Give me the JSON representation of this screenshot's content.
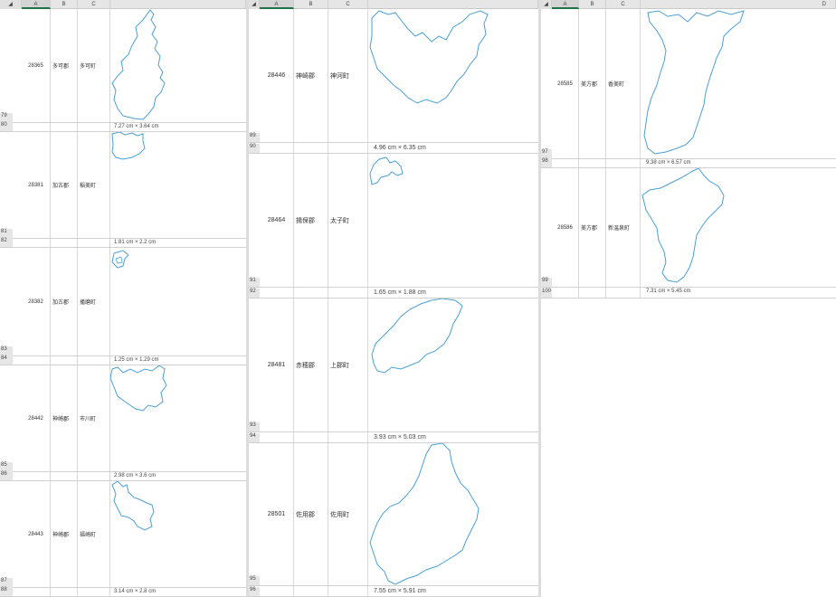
{
  "panes": [
    {
      "columns": [
        "A",
        "B",
        "C"
      ],
      "rows": [
        {
          "num": "79",
          "code": "28365",
          "district": "多可郡",
          "town": "多可町"
        },
        {
          "num": "80",
          "size": "7.27 cm × 3.64 cm"
        },
        {
          "num": "81",
          "code": "28381",
          "district": "加古郡",
          "town": "稲美町"
        },
        {
          "num": "82",
          "size": "1.81 cm × 2.2 cm"
        },
        {
          "num": "83",
          "code": "28382",
          "district": "加古郡",
          "town": "播磨町"
        },
        {
          "num": "84",
          "size": "1.25 cm × 1.29 cm"
        },
        {
          "num": "85",
          "code": "28442",
          "district": "神崎郡",
          "town": "市川町"
        },
        {
          "num": "86",
          "size": "2.98 cm × 3.6 cm"
        },
        {
          "num": "87",
          "code": "28443",
          "district": "神崎郡",
          "town": "福崎町"
        },
        {
          "num": "88",
          "size": "3.14 cm × 2.8 cm"
        }
      ]
    },
    {
      "columns": [
        "A",
        "B",
        "C"
      ],
      "rows": [
        {
          "num": "89",
          "code": "28446",
          "district": "神崎郡",
          "town": "神河町"
        },
        {
          "num": "90",
          "size": "4.96 cm × 6.35 cm"
        },
        {
          "num": "91",
          "code": "28464",
          "district": "揖保郡",
          "town": "太子町"
        },
        {
          "num": "92",
          "size": "1.65 cm × 1.88 cm"
        },
        {
          "num": "93",
          "code": "28481",
          "district": "赤穂郡",
          "town": "上郡町"
        },
        {
          "num": "94",
          "size": "3.93 cm × 5.03 cm"
        },
        {
          "num": "95",
          "code": "28501",
          "district": "佐用郡",
          "town": "佐用町"
        },
        {
          "num": "96",
          "size": "7.55 cm × 5.91 cm"
        }
      ]
    },
    {
      "columns": [
        "A",
        "B",
        "C",
        "D"
      ],
      "rows": [
        {
          "num": "97",
          "code": "28585",
          "district": "美方郡",
          "town": "香美町"
        },
        {
          "num": "98",
          "size": "9.38 cm × 6.57 cm"
        },
        {
          "num": "99",
          "code": "28586",
          "district": "美方郡",
          "town": "新温泉町"
        },
        {
          "num": "100",
          "size": "7.31 cm × 5.45 cm"
        }
      ]
    }
  ],
  "colors": {
    "outline": "#4a9fd6",
    "header_bg": "#e6e6e6",
    "accent": "#217346"
  }
}
